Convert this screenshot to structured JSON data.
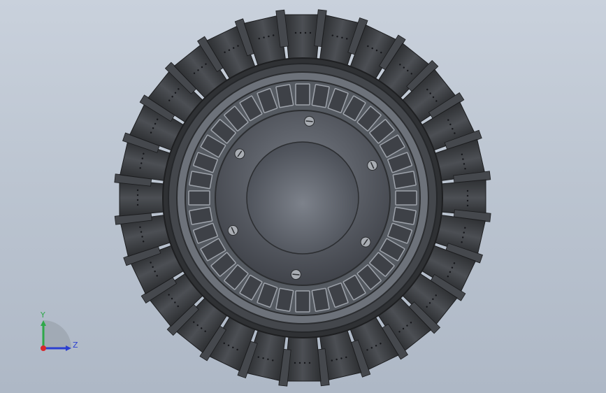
{
  "viewport": {
    "background_top": "#c9d1dc",
    "background_bottom": "#aeb8c6",
    "model": {
      "part_color": "#3b3d40",
      "ring_color": "#6f747c",
      "hub_color": "#5a5e66",
      "coil_color": "#8fb58a",
      "slot_count": 36,
      "blade_count": 28,
      "screw_count": 6
    }
  },
  "triad": {
    "y_label": "Y",
    "z_label": "Z",
    "y_color": "#2fa84a",
    "z_color": "#2b3fd0",
    "origin_color": "#d8262c"
  }
}
